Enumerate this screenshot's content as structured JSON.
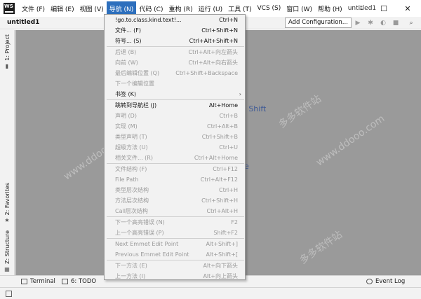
{
  "menubar": {
    "app_logo": "WS",
    "items": [
      "文件 (F)",
      "编辑 (E)",
      "视图 (V)",
      "导航 (N)",
      "代码 (C)",
      "重构 (R)",
      "运行 (U)",
      "工具 (T)",
      "VCS (S)",
      "窗口 (W)",
      "帮助 (H)"
    ],
    "active_index": 3,
    "window_title": "untitled1"
  },
  "window_controls": {
    "minimize": "–",
    "maximize": "☐",
    "close": "✕"
  },
  "toolbar": {
    "project_name": "untitled1",
    "add_config_label": "Add Configuration...",
    "icons": [
      "run-icon",
      "debug-icon",
      "coverage-icon",
      "stop-icon",
      "search-icon"
    ]
  },
  "left_tabs": {
    "project": "1: Project",
    "favorites": "2: Favorites",
    "structure": "Z: Structure"
  },
  "bottom_tabs": {
    "terminal": "Terminal",
    "todo": "6: TODO",
    "event_log": "Event Log"
  },
  "editor_hints": {
    "hint_1": "le Shift",
    "hint_2": "e"
  },
  "watermarks": [
    "多多软件站",
    "www.ddooo.com"
  ],
  "dropdown": {
    "items": [
      {
        "label": "!go.to.class.kind.text!...",
        "shortcut": "Ctrl+N",
        "disabled": false
      },
      {
        "label": "文件... (F)",
        "shortcut": "Ctrl+Shift+N",
        "disabled": false
      },
      {
        "label": "符号... (S)",
        "shortcut": "Ctrl+Alt+Shift+N",
        "disabled": false
      },
      {
        "sep": true
      },
      {
        "label": "后退 (B)",
        "shortcut": "Ctrl+Alt+向左箭头",
        "disabled": true
      },
      {
        "label": "向前 (W)",
        "shortcut": "Ctrl+Alt+向右箭头",
        "disabled": true
      },
      {
        "label": "最后编辑位置 (Q)",
        "shortcut": "Ctrl+Shift+Backspace",
        "disabled": true
      },
      {
        "label": "下一个编辑位置",
        "shortcut": "",
        "disabled": true
      },
      {
        "label": "书签 (K)",
        "shortcut": "",
        "disabled": false,
        "submenu": true
      },
      {
        "sep": true
      },
      {
        "label": "跳转到导航栏 (J)",
        "shortcut": "Alt+Home",
        "disabled": false
      },
      {
        "label": "声明 (D)",
        "shortcut": "Ctrl+B",
        "disabled": true
      },
      {
        "label": "实现 (M)",
        "shortcut": "Ctrl+Alt+B",
        "disabled": true
      },
      {
        "label": "类型声明 (T)",
        "shortcut": "Ctrl+Shift+B",
        "disabled": true
      },
      {
        "label": "超级方法 (U)",
        "shortcut": "Ctrl+U",
        "disabled": true
      },
      {
        "label": "相关文件... (R)",
        "shortcut": "Ctrl+Alt+Home",
        "disabled": true
      },
      {
        "sep": true
      },
      {
        "label": "文件结构 (F)",
        "shortcut": "Ctrl+F12",
        "disabled": true
      },
      {
        "label": "File Path",
        "shortcut": "Ctrl+Alt+F12",
        "disabled": true
      },
      {
        "label": "类型层次结构",
        "shortcut": "Ctrl+H",
        "disabled": true
      },
      {
        "label": "方法层次结构",
        "shortcut": "Ctrl+Shift+H",
        "disabled": true
      },
      {
        "label": "Call层次结构",
        "shortcut": "Ctrl+Alt+H",
        "disabled": true
      },
      {
        "sep": true
      },
      {
        "label": "下一个高亮错误 (N)",
        "shortcut": "F2",
        "disabled": true
      },
      {
        "label": "上一个高亮错误 (P)",
        "shortcut": "Shift+F2",
        "disabled": true
      },
      {
        "sep": true
      },
      {
        "label": "Next Emmet Edit Point",
        "shortcut": "Alt+Shift+]",
        "disabled": true
      },
      {
        "label": "Previous Emmet Edit Point",
        "shortcut": "Alt+Shift+[",
        "disabled": true
      },
      {
        "sep": true
      },
      {
        "label": "下一方法 (E)",
        "shortcut": "Alt+向下箭头",
        "disabled": true
      },
      {
        "label": "上一方法 (I)",
        "shortcut": "Alt+向上箭头",
        "disabled": true
      }
    ]
  }
}
